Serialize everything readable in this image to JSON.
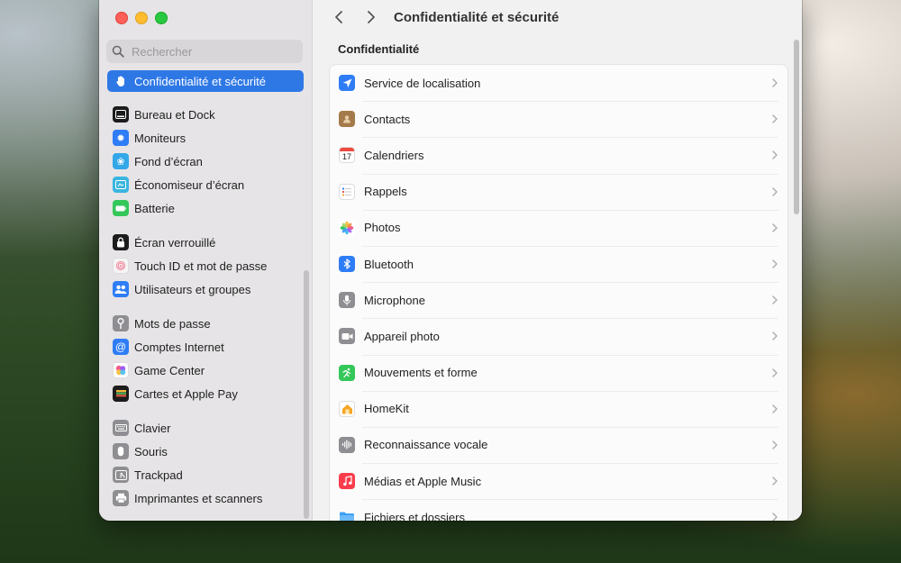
{
  "window": {
    "title": "Confidentialité et sécurité"
  },
  "search": {
    "placeholder": "Rechercher"
  },
  "sidebar": {
    "items": [
      {
        "label": "Confidentialité et sécurité",
        "icon": "hand-icon",
        "color": "#2e78e6",
        "selected": true
      },
      {
        "label": "Bureau et Dock",
        "icon": "dock-icon",
        "color": "#1c1c1c"
      },
      {
        "label": "Moniteurs",
        "icon": "sun-icon",
        "color": "#2f7df6"
      },
      {
        "label": "Fond d’écran",
        "icon": "flower-icon",
        "color": "#34a7e8"
      },
      {
        "label": "Économiseur d’écran",
        "icon": "screensaver-icon",
        "color": "#39b5df"
      },
      {
        "label": "Batterie",
        "icon": "battery-icon",
        "color": "#34c759"
      },
      {
        "label": "Écran verrouillé",
        "icon": "lock-icon",
        "color": "#1c1c1c"
      },
      {
        "label": "Touch ID et mot de passe",
        "icon": "fingerprint-icon",
        "color": "#f2f2f2"
      },
      {
        "label": "Utilisateurs et groupes",
        "icon": "users-icon",
        "color": "#2f7df6"
      },
      {
        "label": "Mots de passe",
        "icon": "key-icon",
        "color": "#8e8e93"
      },
      {
        "label": "Comptes Internet",
        "icon": "at-icon",
        "color": "#2f7df6"
      },
      {
        "label": "Game Center",
        "icon": "game-center-icon",
        "color": "#ffffff"
      },
      {
        "label": "Cartes et Apple Pay",
        "icon": "wallet-icon",
        "color": "#1c1c1c"
      },
      {
        "label": "Clavier",
        "icon": "keyboard-icon",
        "color": "#8e8e93"
      },
      {
        "label": "Souris",
        "icon": "mouse-icon",
        "color": "#8e8e93"
      },
      {
        "label": "Trackpad",
        "icon": "trackpad-icon",
        "color": "#8e8e93"
      },
      {
        "label": "Imprimantes et scanners",
        "icon": "printer-icon",
        "color": "#8e8e93"
      }
    ]
  },
  "main": {
    "section_title": "Confidentialité",
    "rows": [
      {
        "label": "Service de localisation",
        "icon": "location-arrow-icon",
        "color": "#2f7df6"
      },
      {
        "label": "Contacts",
        "icon": "contacts-icon",
        "color": "#a57a4a"
      },
      {
        "label": "Calendriers",
        "icon": "calendar-icon",
        "color": "#ffffff",
        "badge": "17"
      },
      {
        "label": "Rappels",
        "icon": "reminders-icon",
        "color": "#ffffff"
      },
      {
        "label": "Photos",
        "icon": "photos-icon",
        "color": "#ffffff"
      },
      {
        "label": "Bluetooth",
        "icon": "bluetooth-icon",
        "color": "#2f7df6"
      },
      {
        "label": "Microphone",
        "icon": "microphone-icon",
        "color": "#8e8e93"
      },
      {
        "label": "Appareil photo",
        "icon": "camera-icon",
        "color": "#8e8e93"
      },
      {
        "label": "Mouvements et forme",
        "icon": "fitness-icon",
        "color": "#34c759"
      },
      {
        "label": "HomeKit",
        "icon": "home-icon",
        "color": "#ffffff"
      },
      {
        "label": "Reconnaissance vocale",
        "icon": "waveform-icon",
        "color": "#8e8e93"
      },
      {
        "label": "Médias et Apple Music",
        "icon": "music-icon",
        "color": "#fa3c4c"
      },
      {
        "label": "Fichiers et dossiers",
        "icon": "folder-icon",
        "color": "#3ba0f5"
      }
    ]
  }
}
